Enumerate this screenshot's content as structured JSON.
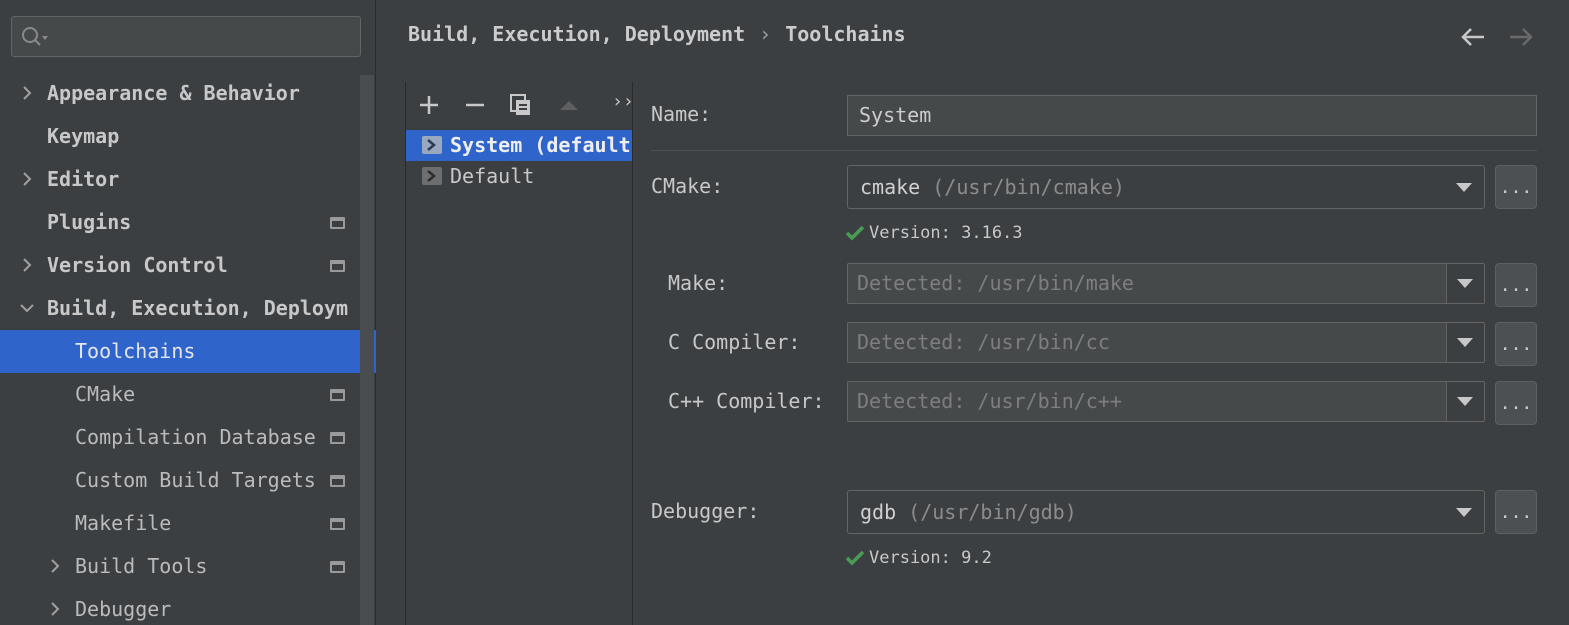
{
  "search": {
    "placeholder": ""
  },
  "sidebar": {
    "items": [
      {
        "label": "Appearance & Behavior"
      },
      {
        "label": "Keymap"
      },
      {
        "label": "Editor"
      },
      {
        "label": "Plugins"
      },
      {
        "label": "Version Control"
      },
      {
        "label": "Build, Execution, Deploym"
      },
      {
        "label": "Toolchains"
      },
      {
        "label": "CMake"
      },
      {
        "label": "Compilation Database"
      },
      {
        "label": "Custom Build Targets"
      },
      {
        "label": "Makefile"
      },
      {
        "label": "Build Tools"
      },
      {
        "label": "Debugger"
      }
    ]
  },
  "header": {
    "breadcrumb_parent": "Build, Execution, Deployment",
    "breadcrumb_separator": "›",
    "breadcrumb_current": "Toolchains"
  },
  "toolchains": {
    "items": [
      {
        "label": "System (default)"
      },
      {
        "label": "Default"
      }
    ],
    "more_label": "››"
  },
  "form": {
    "name_label": "Name:",
    "name_value": "System",
    "cmake_label": "CMake:",
    "cmake_value": "cmake",
    "cmake_path": "(/usr/bin/cmake)",
    "cmake_version": "Version: 3.16.3",
    "make_label": "Make:",
    "make_value": "Detected: /usr/bin/make",
    "c_label": "C Compiler:",
    "c_value": "Detected: /usr/bin/cc",
    "cpp_label": "C++ Compiler:",
    "cpp_value": "Detected: /usr/bin/c++",
    "debugger_label": "Debugger:",
    "debugger_value": "gdb",
    "debugger_path": "(/usr/bin/gdb)",
    "debugger_version": "Version: 9.2",
    "browse_label": "..."
  },
  "colors": {
    "selection": "#2f65ca",
    "check": "#499c54",
    "background": "#3c3f41"
  }
}
